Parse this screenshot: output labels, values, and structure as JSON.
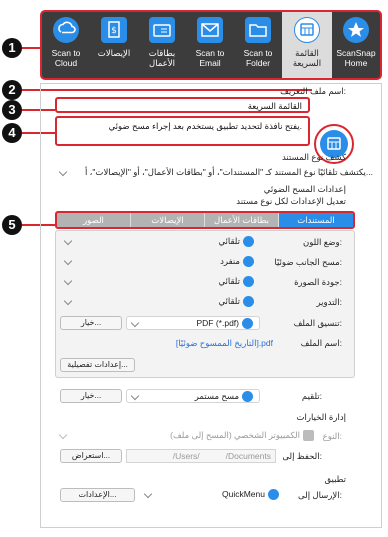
{
  "toolbar": {
    "items": [
      {
        "label": "Scan to\nCloud",
        "icon": "cloud-scan-icon"
      },
      {
        "label": "الإيصالات",
        "icon": "receipt-icon"
      },
      {
        "label": "بطاقات\nالأعمال",
        "icon": "business-card-icon"
      },
      {
        "label": "Scan to\nEmail",
        "icon": "email-icon"
      },
      {
        "label": "Scan to\nFolder",
        "icon": "folder-icon"
      },
      {
        "label": "القائمة\nالسريعة",
        "icon": "quickmenu-icon"
      },
      {
        "label": "ScanSnap\nHome",
        "icon": "scansnap-home-icon"
      }
    ]
  },
  "callouts": [
    "1",
    "2",
    "3",
    "4",
    "5"
  ],
  "profile": {
    "name_label": "اسم ملف التعريف:",
    "name_value": "القائمة السريعة",
    "description": "يفتح نافذة لتحديد تطبيق يستخدم بعد إجراء مسح ضوئي."
  },
  "doc_type": {
    "heading": "كشف نوع المستند",
    "value": "يكتشف تلقائيًا نوع المستند كـ \"المستندات\"، أو \"بطاقات الأعمال\"، أو \"الإيصالات\"، أ..."
  },
  "scan_settings": {
    "heading": "إعدادات المسح الضوئي",
    "subheading": "تعديل الإعدادات لكل نوع مستند",
    "tabs": [
      "المستندات",
      "بطاقات الأعمال",
      "الإيصالات",
      "الصور"
    ],
    "rows": [
      {
        "label": "وضع اللون:",
        "value": "تلقائي"
      },
      {
        "label": "مسح الجانب ضوئيًا:",
        "value": "منفرد"
      },
      {
        "label": "جودة الصورة:",
        "value": "تلقائي"
      },
      {
        "label": "التدوير:",
        "value": "تلقائي"
      }
    ],
    "file_format_label": "تنسيق الملف:",
    "file_format_value": "PDF (*.pdf)",
    "options_button": "خيار...",
    "file_name_label": "اسم الملف:",
    "file_name_value": "[التاريخ الممسوح ضوئيًا].pdf",
    "detailed_button": "إعدادات تفصيلية..."
  },
  "feed": {
    "label": "تلقيم:",
    "value": "مسح مستمر",
    "options_button": "خيار..."
  },
  "manage": {
    "heading": "إدارة الخيارات",
    "type_label": "النوع:",
    "type_value": "الكمبيوتر الشخصي (المسح إلى ملف)",
    "save_label": "الحفظ إلى:",
    "save_value": "/Users/           /Documents",
    "browse_button": "استعراض..."
  },
  "app": {
    "heading": "تطبيق",
    "send_label": "الإرسال إلى:",
    "send_value": "QuickMenu",
    "settings_button": "الإعدادات..."
  },
  "colors": {
    "accent": "#2a8de8",
    "callout_line": "#d9262f",
    "toolbar_bg": "#3c3c3c"
  }
}
